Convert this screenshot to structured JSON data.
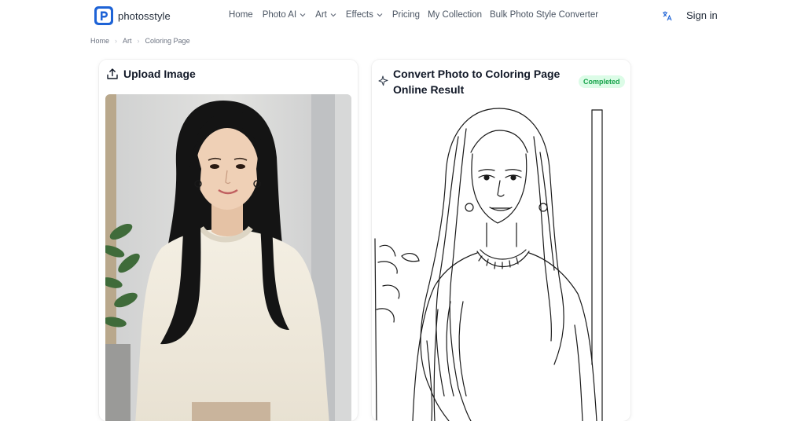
{
  "brand": {
    "name": "photosstyle",
    "logo_letter": "P"
  },
  "nav": {
    "items": [
      {
        "label": "Home",
        "dropdown": false
      },
      {
        "label": "Photo AI",
        "dropdown": true
      },
      {
        "label": "Art",
        "dropdown": true
      },
      {
        "label": "Effects",
        "dropdown": true
      },
      {
        "label": "Pricing",
        "dropdown": false
      },
      {
        "label": "My Collection",
        "dropdown": false
      },
      {
        "label": "Bulk Photo Style Converter",
        "dropdown": false
      }
    ],
    "translate_icon": "translate-icon",
    "signin_label": "Sign in"
  },
  "breadcrumb": [
    "Home",
    "Art",
    "Coloring Page"
  ],
  "upload": {
    "title": "Upload Image",
    "icon": "upload-icon"
  },
  "result": {
    "title_line1": "Convert Photo to Coloring Page",
    "title_line2": "Online Result",
    "icon": "sparkle-icon",
    "status": "Completed"
  },
  "colors": {
    "brand": "#1e63d6",
    "status_bg": "#dcfce7",
    "status_text": "#16a34a"
  }
}
